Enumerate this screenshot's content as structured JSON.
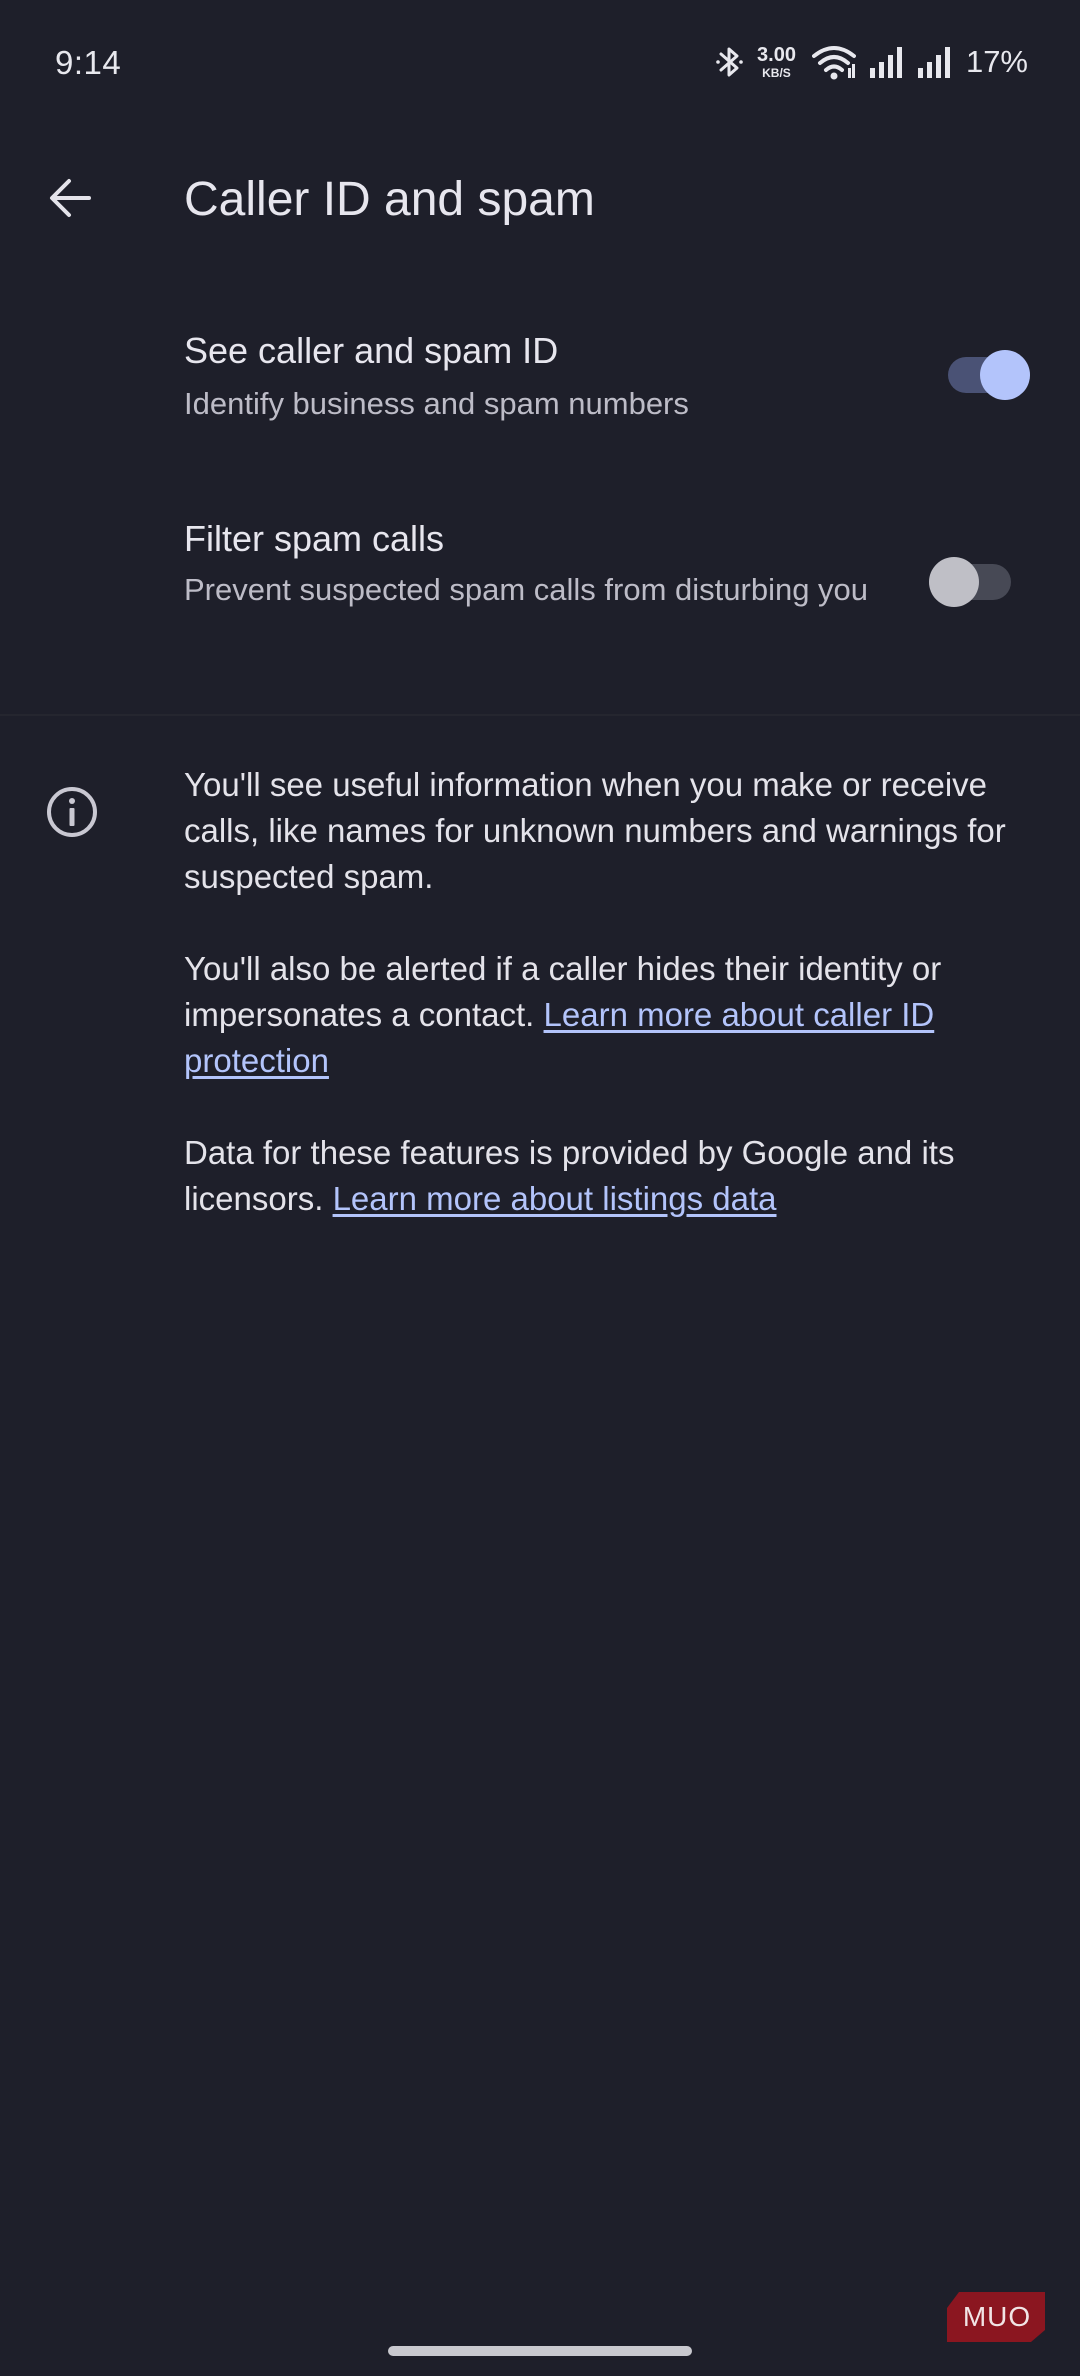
{
  "status_bar": {
    "time": "9:14",
    "net_speed_value": "3.00",
    "net_speed_unit": "KB/S",
    "battery": "17%",
    "icons": [
      "bluetooth-icon",
      "wifi-icon",
      "signal-icon",
      "signal-icon"
    ]
  },
  "app_bar": {
    "title": "Caller ID and spam",
    "back_icon": "arrow-back-icon"
  },
  "settings": [
    {
      "title": "See caller and spam ID",
      "summary": "Identify business and spam numbers",
      "enabled": true
    },
    {
      "title": "Filter spam calls",
      "summary": "Prevent suspected spam calls from disturbing you",
      "enabled": false
    }
  ],
  "info": {
    "icon": "info-icon",
    "paragraph1": "You'll see useful information when you make or receive calls, like names for unknown numbers and warnings for suspected spam.",
    "paragraph2_text": "You'll also be alerted if a caller hides their identity or impersonates a contact. ",
    "paragraph2_link": "Learn more about caller ID protection",
    "paragraph3_text": "Data for these features is provided by Google and its licensors. ",
    "paragraph3_link": "Learn more about listings data"
  },
  "watermark": {
    "text": "MUO"
  },
  "colors": {
    "background": "#1e1f2a",
    "accent": "#b3c4fb",
    "switch_on_track": "#4a5275",
    "switch_off_track": "#474955",
    "switch_off_thumb": "#bfbfc6",
    "watermark_red": "#8b1620"
  }
}
